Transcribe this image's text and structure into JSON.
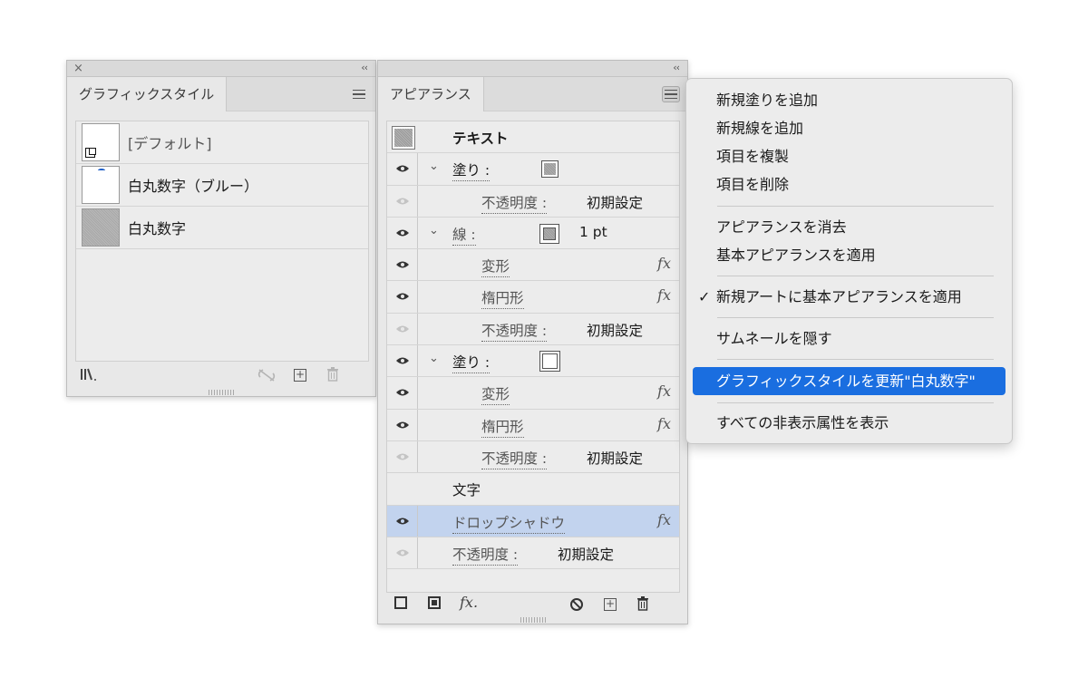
{
  "graphic_styles_panel": {
    "tab_label": "グラフィックスタイル",
    "collapse_glyph": "‹‹",
    "close_glyph": "×",
    "items": [
      {
        "label": "[デフォルト]"
      },
      {
        "label": "白丸数字（ブルー）"
      },
      {
        "label": "白丸数字"
      }
    ],
    "footer": {
      "library_glyph": "‖\\.",
      "break_link_glyph": "⛓",
      "new_glyph": "+",
      "delete_glyph": "🗑"
    }
  },
  "appearance_panel": {
    "tab_label": "アピアランス",
    "collapse_glyph": "‹‹",
    "header": {
      "label": "テキスト"
    },
    "rows": [
      {
        "label": "塗り :"
      },
      {
        "label": "不透明度 :",
        "value": "初期設定"
      },
      {
        "label": "線 :",
        "value": "1 pt"
      },
      {
        "label": "変形",
        "fx": "fx"
      },
      {
        "label": "楕円形",
        "fx": "fx"
      },
      {
        "label": "不透明度 :",
        "value": "初期設定"
      },
      {
        "label": "塗り :"
      },
      {
        "label": "変形",
        "fx": "fx"
      },
      {
        "label": "楕円形",
        "fx": "fx"
      },
      {
        "label": "不透明度 :",
        "value": "初期設定"
      },
      {
        "label": "文字"
      },
      {
        "label": "ドロップシャドウ",
        "fx": "fx"
      },
      {
        "label": "不透明度 :",
        "value": "初期設定"
      }
    ],
    "footer": {
      "fx_label": "fx."
    }
  },
  "flyout_menu": {
    "items": [
      {
        "label": "新規塗りを追加"
      },
      {
        "label": "新規線を追加"
      },
      {
        "label": "項目を複製"
      },
      {
        "label": "項目を削除"
      },
      {
        "label": "アピアランスを消去"
      },
      {
        "label": "基本アピアランスを適用"
      },
      {
        "label": "新規アートに基本アピアランスを適用",
        "check": "✓"
      },
      {
        "label": "サムネールを隠す"
      },
      {
        "label": "グラフィックスタイルを更新\"白丸数字\""
      },
      {
        "label": "すべての非表示属性を表示"
      }
    ]
  },
  "colors": {
    "selection_row": "#c2d3ee",
    "menu_highlight": "#1a6ee0",
    "panel_bg": "#e8e8e8"
  }
}
